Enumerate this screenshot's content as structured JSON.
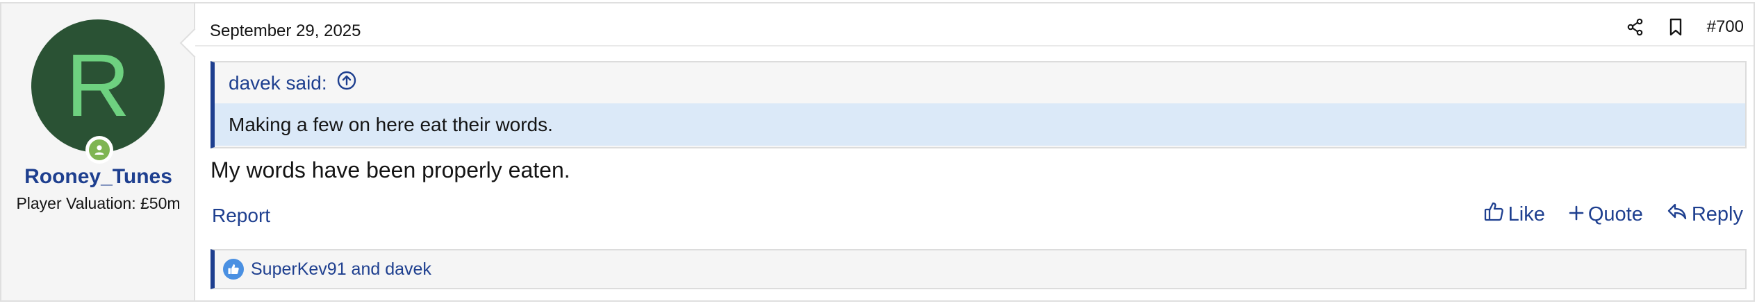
{
  "user": {
    "avatar_letter": "R",
    "username": "Rooney_Tunes",
    "title": "Player Valuation: £50m",
    "avatar_bg": "#2a5234",
    "avatar_fg": "#6ed180",
    "status_icon": "online-user-icon"
  },
  "post": {
    "date": "September 29, 2025",
    "number": "#700",
    "header_icons": [
      "share-icon",
      "bookmark-icon"
    ],
    "quote": {
      "author_label": "davek said:",
      "text": "Making a few on here eat their words."
    },
    "message": "My words have been properly eaten.",
    "report_label": "Report",
    "actions": {
      "like_label": "Like",
      "quote_label": "Quote",
      "reply_label": "Reply"
    },
    "reactions": {
      "names": "SuperKev91 and davek",
      "icon": "thumbs-up-reaction-icon"
    }
  },
  "colors": {
    "link": "#1e3f8f",
    "quote_highlight": "#dbe9f8",
    "sidebar_bg": "#f5f5f5"
  }
}
